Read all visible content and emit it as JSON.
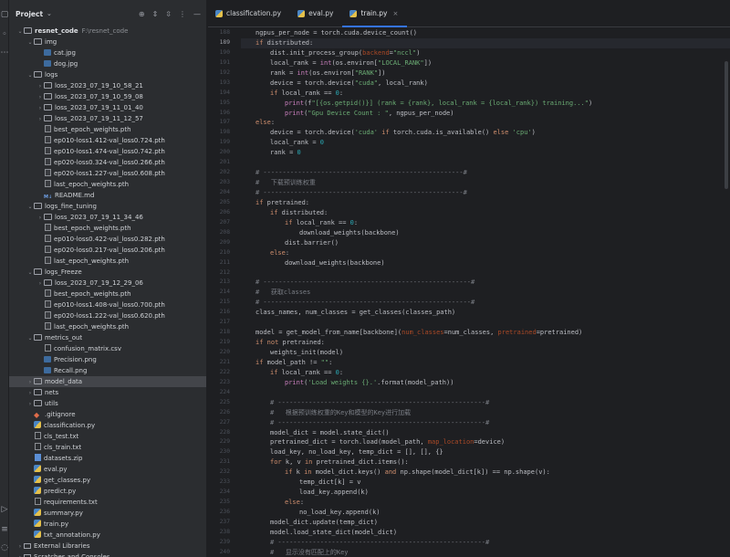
{
  "project": {
    "title": "Project",
    "root": {
      "name": "resnet_code",
      "path": "F:\\resnet_code"
    },
    "items": [
      {
        "depth": 1,
        "arrow": "v",
        "icon": "folder",
        "label": "img"
      },
      {
        "depth": 2,
        "arrow": "",
        "icon": "img",
        "label": "cat.jpg"
      },
      {
        "depth": 2,
        "arrow": "",
        "icon": "img",
        "label": "dog.jpg"
      },
      {
        "depth": 1,
        "arrow": "v",
        "icon": "folder",
        "label": "logs"
      },
      {
        "depth": 2,
        "arrow": ">",
        "icon": "folder",
        "label": "loss_2023_07_19_10_58_21"
      },
      {
        "depth": 2,
        "arrow": ">",
        "icon": "folder",
        "label": "loss_2023_07_19_10_59_08"
      },
      {
        "depth": 2,
        "arrow": ">",
        "icon": "folder",
        "label": "loss_2023_07_19_11_01_40"
      },
      {
        "depth": 2,
        "arrow": ">",
        "icon": "folder",
        "label": "loss_2023_07_19_11_12_57"
      },
      {
        "depth": 2,
        "arrow": "",
        "icon": "pth",
        "label": "best_epoch_weights.pth"
      },
      {
        "depth": 2,
        "arrow": "",
        "icon": "pth",
        "label": "ep010-loss1.412-val_loss0.724.pth"
      },
      {
        "depth": 2,
        "arrow": "",
        "icon": "pth",
        "label": "ep010-loss1.474-val_loss0.742.pth"
      },
      {
        "depth": 2,
        "arrow": "",
        "icon": "pth",
        "label": "ep020-loss0.324-val_loss0.266.pth"
      },
      {
        "depth": 2,
        "arrow": "",
        "icon": "pth",
        "label": "ep020-loss1.227-val_loss0.608.pth"
      },
      {
        "depth": 2,
        "arrow": "",
        "icon": "pth",
        "label": "last_epoch_weights.pth"
      },
      {
        "depth": 2,
        "arrow": "",
        "icon": "md",
        "label": "README.md"
      },
      {
        "depth": 1,
        "arrow": "v",
        "icon": "folder",
        "label": "logs_fine_tuning"
      },
      {
        "depth": 2,
        "arrow": ">",
        "icon": "folder",
        "label": "loss_2023_07_19_11_34_46"
      },
      {
        "depth": 2,
        "arrow": "",
        "icon": "pth",
        "label": "best_epoch_weights.pth"
      },
      {
        "depth": 2,
        "arrow": "",
        "icon": "pth",
        "label": "ep010-loss0.422-val_loss0.282.pth"
      },
      {
        "depth": 2,
        "arrow": "",
        "icon": "pth",
        "label": "ep020-loss0.217-val_loss0.206.pth"
      },
      {
        "depth": 2,
        "arrow": "",
        "icon": "pth",
        "label": "last_epoch_weights.pth"
      },
      {
        "depth": 1,
        "arrow": "v",
        "icon": "folder",
        "label": "logs_Freeze"
      },
      {
        "depth": 2,
        "arrow": ">",
        "icon": "folder",
        "label": "loss_2023_07_19_12_29_06"
      },
      {
        "depth": 2,
        "arrow": "",
        "icon": "pth",
        "label": "best_epoch_weights.pth"
      },
      {
        "depth": 2,
        "arrow": "",
        "icon": "pth",
        "label": "ep010-loss1.408-val_loss0.700.pth"
      },
      {
        "depth": 2,
        "arrow": "",
        "icon": "pth",
        "label": "ep020-loss1.222-val_loss0.620.pth"
      },
      {
        "depth": 2,
        "arrow": "",
        "icon": "pth",
        "label": "last_epoch_weights.pth"
      },
      {
        "depth": 1,
        "arrow": "v",
        "icon": "folder",
        "label": "metrics_out"
      },
      {
        "depth": 2,
        "arrow": "",
        "icon": "csv",
        "label": "confusion_matrix.csv"
      },
      {
        "depth": 2,
        "arrow": "",
        "icon": "img",
        "label": "Precision.png"
      },
      {
        "depth": 2,
        "arrow": "",
        "icon": "img",
        "label": "Recall.png"
      },
      {
        "depth": 1,
        "arrow": ">",
        "icon": "folder",
        "label": "model_data",
        "selected": true
      },
      {
        "depth": 1,
        "arrow": ">",
        "icon": "folder",
        "label": "nets"
      },
      {
        "depth": 1,
        "arrow": ">",
        "icon": "folder",
        "label": "utils"
      },
      {
        "depth": 1,
        "arrow": "",
        "icon": "git",
        "label": ".gitignore"
      },
      {
        "depth": 1,
        "arrow": "",
        "icon": "py",
        "label": "classification.py"
      },
      {
        "depth": 1,
        "arrow": "",
        "icon": "file",
        "label": "cls_test.txt"
      },
      {
        "depth": 1,
        "arrow": "",
        "icon": "file",
        "label": "cls_train.txt"
      },
      {
        "depth": 1,
        "arrow": "",
        "icon": "zip",
        "label": "datasets.zip"
      },
      {
        "depth": 1,
        "arrow": "",
        "icon": "py",
        "label": "eval.py"
      },
      {
        "depth": 1,
        "arrow": "",
        "icon": "py",
        "label": "get_classes.py"
      },
      {
        "depth": 1,
        "arrow": "",
        "icon": "py",
        "label": "predict.py"
      },
      {
        "depth": 1,
        "arrow": "",
        "icon": "file",
        "label": "requirements.txt"
      },
      {
        "depth": 1,
        "arrow": "",
        "icon": "py",
        "label": "summary.py"
      },
      {
        "depth": 1,
        "arrow": "",
        "icon": "py",
        "label": "train.py"
      },
      {
        "depth": 1,
        "arrow": "",
        "icon": "py",
        "label": "txt_annotation.py"
      },
      {
        "depth": 0,
        "arrow": ">",
        "icon": "lib",
        "label": "External Libraries"
      },
      {
        "depth": 0,
        "arrow": ">",
        "icon": "lib",
        "label": "Scratches and Consoles"
      }
    ]
  },
  "tabs": [
    {
      "label": "classification.py",
      "active": false
    },
    {
      "label": "eval.py",
      "active": false
    },
    {
      "label": "train.py",
      "active": true,
      "close": "×"
    }
  ],
  "code": {
    "current_line": 189,
    "lines": [
      {
        "n": 188,
        "ind": 1,
        "t": "ngpus_per_node = torch.cuda.device_count()"
      },
      {
        "n": 189,
        "ind": 1,
        "t": "if distributed:"
      },
      {
        "n": 190,
        "ind": 2,
        "t": "dist.init_process_group(backend=\"nccl\")"
      },
      {
        "n": 191,
        "ind": 2,
        "t": "local_rank = int(os.environ[\"LOCAL_RANK\"])"
      },
      {
        "n": 192,
        "ind": 2,
        "t": "rank = int(os.environ[\"RANK\"])"
      },
      {
        "n": 193,
        "ind": 2,
        "t": "device = torch.device(\"cuda\", local_rank)"
      },
      {
        "n": 194,
        "ind": 2,
        "t": "if local_rank == 0:"
      },
      {
        "n": 195,
        "ind": 3,
        "t": "print(f\"[{os.getpid()}] (rank = {rank}, local_rank = {local_rank}) training...\")"
      },
      {
        "n": 196,
        "ind": 3,
        "t": "print(\"Gpu Device Count : \", ngpus_per_node)"
      },
      {
        "n": 197,
        "ind": 1,
        "t": "else:"
      },
      {
        "n": 198,
        "ind": 2,
        "t": "device = torch.device('cuda' if torch.cuda.is_available() else 'cpu')"
      },
      {
        "n": 199,
        "ind": 2,
        "t": "local_rank = 0"
      },
      {
        "n": 200,
        "ind": 2,
        "t": "rank = 0"
      },
      {
        "n": 201,
        "ind": 0,
        "t": ""
      },
      {
        "n": 202,
        "ind": 1,
        "t": "# ----------------------------------------------------#"
      },
      {
        "n": 203,
        "ind": 1,
        "t": "#   下载预训练权重"
      },
      {
        "n": 204,
        "ind": 1,
        "t": "# ----------------------------------------------------#"
      },
      {
        "n": 205,
        "ind": 1,
        "t": "if pretrained:"
      },
      {
        "n": 206,
        "ind": 2,
        "t": "if distributed:"
      },
      {
        "n": 207,
        "ind": 3,
        "t": "if local_rank == 0:"
      },
      {
        "n": 208,
        "ind": 4,
        "t": "download_weights(backbone)"
      },
      {
        "n": 209,
        "ind": 3,
        "t": "dist.barrier()"
      },
      {
        "n": 210,
        "ind": 2,
        "t": "else:"
      },
      {
        "n": 211,
        "ind": 3,
        "t": "download_weights(backbone)"
      },
      {
        "n": 212,
        "ind": 0,
        "t": ""
      },
      {
        "n": 213,
        "ind": 1,
        "t": "# ------------------------------------------------------#"
      },
      {
        "n": 214,
        "ind": 1,
        "t": "#   获取classes"
      },
      {
        "n": 215,
        "ind": 1,
        "t": "# ------------------------------------------------------#"
      },
      {
        "n": 216,
        "ind": 1,
        "t": "class_names, num_classes = get_classes(classes_path)"
      },
      {
        "n": 217,
        "ind": 0,
        "t": ""
      },
      {
        "n": 218,
        "ind": 1,
        "t": "model = get_model_from_name[backbone](num_classes=num_classes, pretrained=pretrained)"
      },
      {
        "n": 219,
        "ind": 1,
        "t": "if not pretrained:"
      },
      {
        "n": 220,
        "ind": 2,
        "t": "weights_init(model)"
      },
      {
        "n": 221,
        "ind": 1,
        "t": "if model_path != \"\":"
      },
      {
        "n": 222,
        "ind": 2,
        "t": "if local_rank == 0:"
      },
      {
        "n": 223,
        "ind": 3,
        "t": "print('Load weights {}.'.format(model_path))"
      },
      {
        "n": 224,
        "ind": 0,
        "t": ""
      },
      {
        "n": 225,
        "ind": 2,
        "t": "# ------------------------------------------------------#"
      },
      {
        "n": 226,
        "ind": 2,
        "t": "#   根据预训练权重的Key和模型的Key进行加载"
      },
      {
        "n": 227,
        "ind": 2,
        "t": "# ------------------------------------------------------#"
      },
      {
        "n": 228,
        "ind": 2,
        "t": "model_dict = model.state_dict()"
      },
      {
        "n": 229,
        "ind": 2,
        "t": "pretrained_dict = torch.load(model_path, map_location=device)"
      },
      {
        "n": 230,
        "ind": 2,
        "t": "load_key, no_load_key, temp_dict = [], [], {}"
      },
      {
        "n": 231,
        "ind": 2,
        "t": "for k, v in pretrained_dict.items():"
      },
      {
        "n": 232,
        "ind": 3,
        "t": "if k in model_dict.keys() and np.shape(model_dict[k]) == np.shape(v):"
      },
      {
        "n": 233,
        "ind": 4,
        "t": "temp_dict[k] = v"
      },
      {
        "n": 234,
        "ind": 4,
        "t": "load_key.append(k)"
      },
      {
        "n": 235,
        "ind": 3,
        "t": "else:"
      },
      {
        "n": 236,
        "ind": 4,
        "t": "no_load_key.append(k)"
      },
      {
        "n": 237,
        "ind": 2,
        "t": "model_dict.update(temp_dict)"
      },
      {
        "n": 238,
        "ind": 2,
        "t": "model.load_state_dict(model_dict)"
      },
      {
        "n": 239,
        "ind": 2,
        "t": "# ------------------------------------------------------#"
      },
      {
        "n": 240,
        "ind": 2,
        "t": "#   显示没有匹配上的Key"
      }
    ]
  },
  "colors": {
    "accent": "#3574f0",
    "keyword": "#cf8e6d",
    "string": "#6aab73",
    "comment": "#7a7e85",
    "number": "#2aacb8",
    "param": "#aa4926"
  }
}
